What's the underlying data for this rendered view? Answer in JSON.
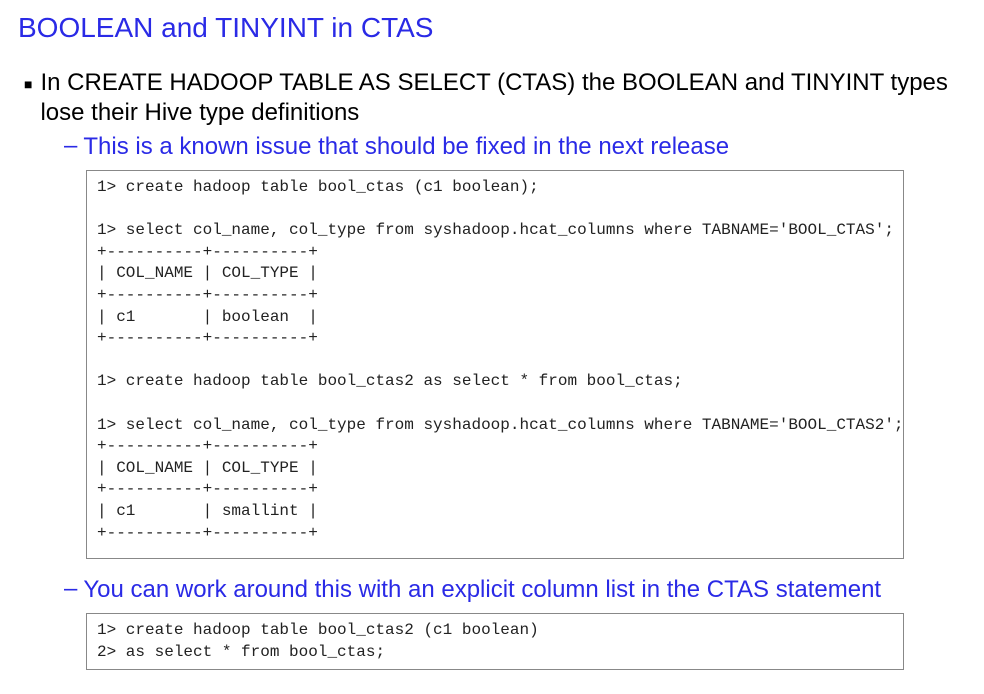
{
  "title": "BOOLEAN and TINYINT in CTAS",
  "bullet": {
    "text": "In CREATE HADOOP TABLE AS SELECT (CTAS) the BOOLEAN and TINYINT types lose their Hive type definitions"
  },
  "sub1": {
    "text": "This is a known issue that should be fixed in the next release"
  },
  "code1": "1> create hadoop table bool_ctas (c1 boolean);\n\n1> select col_name, col_type from syshadoop.hcat_columns where TABNAME='BOOL_CTAS';\n+----------+----------+\n| COL_NAME | COL_TYPE |\n+----------+----------+\n| c1       | boolean  |\n+----------+----------+\n\n1> create hadoop table bool_ctas2 as select * from bool_ctas;\n\n1> select col_name, col_type from syshadoop.hcat_columns where TABNAME='BOOL_CTAS2';\n+----------+----------+\n| COL_NAME | COL_TYPE |\n+----------+----------+\n| c1       | smallint |\n+----------+----------+",
  "sub2": {
    "text": "You can work around this with an explicit column list in the CTAS statement"
  },
  "code2": "1> create hadoop table bool_ctas2 (c1 boolean)\n2> as select * from bool_ctas;"
}
